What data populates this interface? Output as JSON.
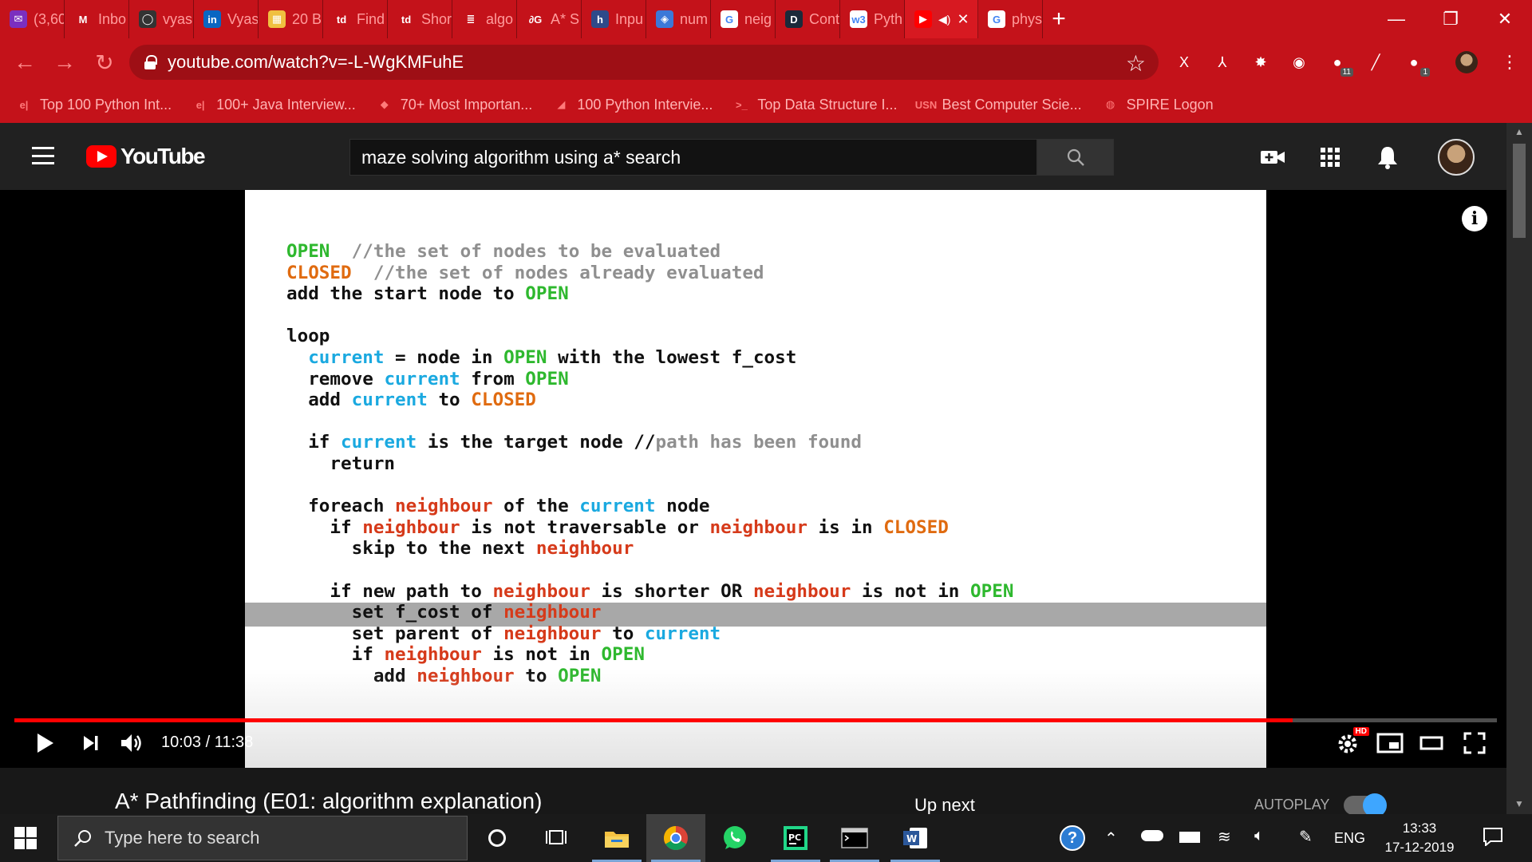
{
  "browser": {
    "tabs": [
      {
        "label": "(3,60",
        "icon": "email-icon",
        "fav_bg": "#7b2fbf",
        "glyph": "✉"
      },
      {
        "label": "Inbo",
        "icon": "gmail-icon",
        "fav_bg": "#c4121a",
        "glyph": "M"
      },
      {
        "label": "vyas",
        "icon": "github-icon",
        "fav_bg": "#333333",
        "glyph": "◯"
      },
      {
        "label": "Vyas",
        "icon": "linkedin-icon",
        "fav_bg": "#0a66c2",
        "glyph": "in"
      },
      {
        "label": "20 B",
        "icon": "grid-icon",
        "fav_bg": "#f0c040",
        "glyph": "▦"
      },
      {
        "label": "Find",
        "icon": "td-icon",
        "fav_bg": "#c4121a",
        "glyph": "td"
      },
      {
        "label": "Shor",
        "icon": "td-icon",
        "fav_bg": "#c4121a",
        "glyph": "td"
      },
      {
        "label": "algo",
        "icon": "stackoverflow-icon",
        "fav_bg": "#c4121a",
        "glyph": "≣"
      },
      {
        "label": "A* S",
        "icon": "code-icon",
        "fav_bg": "#c4121a",
        "glyph": "∂G"
      },
      {
        "label": "Inpu",
        "icon": "hackerrank-icon",
        "fav_bg": "#2e4a8a",
        "glyph": "h"
      },
      {
        "label": "num",
        "icon": "numpy-icon",
        "fav_bg": "#3c78d8",
        "glyph": "◈"
      },
      {
        "label": "neig",
        "icon": "google-icon",
        "fav_bg": "#ffffff",
        "glyph": "G"
      },
      {
        "label": "Cont",
        "icon": "d-icon",
        "fav_bg": "#1b2a3a",
        "glyph": "D"
      },
      {
        "label": "Pyth",
        "icon": "w3schools-icon",
        "fav_bg": "#ffffff",
        "glyph": "w3"
      },
      {
        "label": "",
        "icon": "youtube-icon",
        "fav_bg": "#ff0000",
        "glyph": "▶",
        "active": true
      },
      {
        "label": "phys",
        "icon": "google-icon",
        "fav_bg": "#ffffff",
        "glyph": "G"
      }
    ],
    "new_tab": "+",
    "url": "youtube.com/watch?v=-L-WgKMFuhE",
    "extensions": [
      {
        "name": "excel-ext-icon",
        "glyph": "X"
      },
      {
        "name": "pdf-ext-icon",
        "glyph": "⅄"
      },
      {
        "name": "puzzle-ext-icon",
        "glyph": "✸"
      },
      {
        "name": "circle-ext-icon",
        "glyph": "◉"
      },
      {
        "name": "badge-ext-icon",
        "glyph": "●",
        "badge": "11"
      },
      {
        "name": "pen-ext-icon",
        "glyph": "╱"
      },
      {
        "name": "green-ext-icon",
        "glyph": "●",
        "badge": "1"
      }
    ],
    "bookmarks": [
      {
        "label": "Top 100 Python Int...",
        "icon": "e-icon",
        "glyph": "e|"
      },
      {
        "label": "100+ Java Interview...",
        "icon": "e-icon",
        "glyph": "e|"
      },
      {
        "label": "70+ Most Importan...",
        "icon": "cube-icon",
        "glyph": "◆"
      },
      {
        "label": "100 Python Intervie...",
        "icon": "flame-icon",
        "glyph": "◢"
      },
      {
        "label": "Top Data Structure I...",
        "icon": "arrow-icon",
        "glyph": ">_"
      },
      {
        "label": "Best Computer Scie...",
        "icon": "usn-icon",
        "glyph": "USN"
      },
      {
        "label": "SPIRE Logon",
        "icon": "spire-icon",
        "glyph": "◍"
      }
    ]
  },
  "youtube": {
    "logo_text": "YouTube",
    "search_query": "maze solving algorithm using a* search"
  },
  "slide": {
    "lines": [
      [
        [
          "g",
          "OPEN"
        ],
        [
          "",
          "  "
        ],
        [
          "c",
          "//the set of nodes to be evaluated"
        ]
      ],
      [
        [
          "o",
          "CLOSED"
        ],
        [
          "",
          "  "
        ],
        [
          "c",
          "//the set of nodes already evaluated"
        ]
      ],
      [
        [
          "",
          "add the start node to "
        ],
        [
          "g",
          "OPEN"
        ]
      ],
      [],
      [
        [
          "",
          "loop"
        ]
      ],
      [
        [
          "",
          "",
          " "
        ],
        [
          "b",
          "  current"
        ],
        [
          "",
          " = node in "
        ],
        [
          "g",
          "OPEN"
        ],
        [
          "",
          " with the lowest f_cost"
        ]
      ],
      [
        [
          "",
          "  remove "
        ],
        [
          "b",
          "current"
        ],
        [
          "",
          " from "
        ],
        [
          "g",
          "OPEN"
        ]
      ],
      [
        [
          "",
          "  add "
        ],
        [
          "b",
          "current"
        ],
        [
          "",
          " to "
        ],
        [
          "o",
          "CLOSED"
        ]
      ],
      [],
      [
        [
          "",
          "  if "
        ],
        [
          "b",
          "current"
        ],
        [
          "",
          " is the target node "
        ],
        [
          "",
          "//"
        ],
        [
          "c",
          "path has been found"
        ]
      ],
      [
        [
          "",
          "    return"
        ]
      ],
      [],
      [
        [
          "",
          "  foreach "
        ],
        [
          "r",
          "neighbour"
        ],
        [
          "",
          " of the "
        ],
        [
          "b",
          "current"
        ],
        [
          "",
          " node"
        ]
      ],
      [
        [
          "",
          "    if "
        ],
        [
          "r",
          "neighbour"
        ],
        [
          "",
          " is not traversable or "
        ],
        [
          "r",
          "neighbour"
        ],
        [
          "",
          " is in "
        ],
        [
          "o",
          "CLOSED"
        ]
      ],
      [
        [
          "",
          "      skip to the next "
        ],
        [
          "r",
          "neighbour"
        ]
      ],
      [],
      [
        [
          "",
          "    if new path to "
        ],
        [
          "r",
          "neighbour"
        ],
        [
          "",
          " is shorter OR "
        ],
        [
          "r",
          "neighbour"
        ],
        [
          "",
          " is not in "
        ],
        [
          "g",
          "OPEN"
        ]
      ],
      [
        [
          "",
          "      set f_cost of "
        ],
        [
          "r",
          "neighbour"
        ]
      ],
      [
        [
          "",
          "      set parent of "
        ],
        [
          "r",
          "neighbour"
        ],
        [
          "",
          " to "
        ],
        [
          "b",
          "current"
        ]
      ],
      [
        [
          "",
          "      if "
        ],
        [
          "r",
          "neighbour"
        ],
        [
          "",
          " is not in "
        ],
        [
          "g",
          "OPEN"
        ]
      ],
      [
        [
          "",
          "        add "
        ],
        [
          "r",
          "neighbour"
        ],
        [
          "",
          " to "
        ],
        [
          "g",
          "OPEN"
        ]
      ]
    ]
  },
  "player": {
    "current_time": "10:03",
    "duration": "11:38",
    "time_display": "10:03 / 11:38",
    "progress_fraction": 0.862,
    "hd_badge": "HD"
  },
  "below_video": {
    "title": "A* Pathfinding (E01: algorithm explanation)",
    "up_next": "Up next",
    "autoplay": "AUTOPLAY"
  },
  "taskbar": {
    "search_placeholder": "Type here to search",
    "language": "ENG",
    "time": "13:33",
    "date": "17-12-2019"
  },
  "colors": {
    "browser_red": "#c4121a",
    "youtube_red": "#ff0000",
    "code_green": "#2eb82e",
    "code_orange": "#e06b10",
    "code_blue": "#1aa9e0",
    "code_red": "#d63a1a",
    "code_comment": "#8f8f8f"
  }
}
